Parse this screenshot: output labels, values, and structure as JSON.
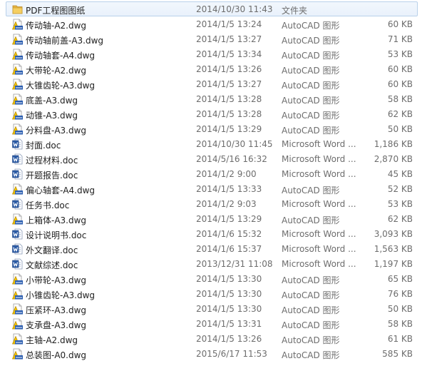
{
  "files": [
    {
      "name": "PDF工程图图纸",
      "date": "2014/10/30 11:43",
      "type": "文件夹",
      "size": "",
      "icon": "folder-icon"
    },
    {
      "name": "传动轴-A2.dwg",
      "date": "2014/1/5 13:24",
      "type": "AutoCAD 图形",
      "size": "60 KB",
      "icon": "autocad-dwg-icon"
    },
    {
      "name": "传动轴前盖-A3.dwg",
      "date": "2014/1/5 13:27",
      "type": "AutoCAD 图形",
      "size": "71 KB",
      "icon": "autocad-dwg-icon"
    },
    {
      "name": "传动轴套-A4.dwg",
      "date": "2014/1/5 13:34",
      "type": "AutoCAD 图形",
      "size": "53 KB",
      "icon": "autocad-dwg-icon"
    },
    {
      "name": "大带轮-A2.dwg",
      "date": "2014/1/5 13:26",
      "type": "AutoCAD 图形",
      "size": "60 KB",
      "icon": "autocad-dwg-icon"
    },
    {
      "name": "大锥齿轮-A3.dwg",
      "date": "2014/1/5 13:27",
      "type": "AutoCAD 图形",
      "size": "60 KB",
      "icon": "autocad-dwg-icon"
    },
    {
      "name": "底盖-A3.dwg",
      "date": "2014/1/5 13:28",
      "type": "AutoCAD 图形",
      "size": "58 KB",
      "icon": "autocad-dwg-icon"
    },
    {
      "name": "动锥-A3.dwg",
      "date": "2014/1/5 13:28",
      "type": "AutoCAD 图形",
      "size": "62 KB",
      "icon": "autocad-dwg-icon"
    },
    {
      "name": "分料盘-A3.dwg",
      "date": "2014/1/5 13:29",
      "type": "AutoCAD 图形",
      "size": "50 KB",
      "icon": "autocad-dwg-icon"
    },
    {
      "name": "封面.doc",
      "date": "2014/10/30 11:45",
      "type": "Microsoft Word ...",
      "size": "1,186 KB",
      "icon": "word-doc-icon"
    },
    {
      "name": "过程材料.doc",
      "date": "2014/5/16 16:32",
      "type": "Microsoft Word ...",
      "size": "2,870 KB",
      "icon": "word-doc-icon"
    },
    {
      "name": "开题报告.doc",
      "date": "2014/1/2 9:00",
      "type": "Microsoft Word ...",
      "size": "45 KB",
      "icon": "word-doc-icon"
    },
    {
      "name": "偏心轴套-A4.dwg",
      "date": "2014/1/5 13:33",
      "type": "AutoCAD 图形",
      "size": "52 KB",
      "icon": "autocad-dwg-icon"
    },
    {
      "name": "任务书.doc",
      "date": "2014/1/2 9:03",
      "type": "Microsoft Word ...",
      "size": "53 KB",
      "icon": "word-doc-icon"
    },
    {
      "name": "上箱体-A3.dwg",
      "date": "2014/1/5 13:29",
      "type": "AutoCAD 图形",
      "size": "62 KB",
      "icon": "autocad-dwg-icon"
    },
    {
      "name": "设计说明书.doc",
      "date": "2014/1/6 15:32",
      "type": "Microsoft Word ...",
      "size": "3,093 KB",
      "icon": "word-doc-icon"
    },
    {
      "name": "外文翻译.doc",
      "date": "2014/1/6 15:37",
      "type": "Microsoft Word ...",
      "size": "1,563 KB",
      "icon": "word-doc-icon"
    },
    {
      "name": "文献综述.doc",
      "date": "2013/12/31 11:08",
      "type": "Microsoft Word ...",
      "size": "1,197 KB",
      "icon": "word-doc-icon"
    },
    {
      "name": "小带轮-A3.dwg",
      "date": "2014/1/5 13:30",
      "type": "AutoCAD 图形",
      "size": "65 KB",
      "icon": "autocad-dwg-icon"
    },
    {
      "name": "小锥齿轮-A3.dwg",
      "date": "2014/1/5 13:30",
      "type": "AutoCAD 图形",
      "size": "76 KB",
      "icon": "autocad-dwg-icon"
    },
    {
      "name": "压紧环-A3.dwg",
      "date": "2014/1/5 13:30",
      "type": "AutoCAD 图形",
      "size": "50 KB",
      "icon": "autocad-dwg-icon"
    },
    {
      "name": "支承盘-A3.dwg",
      "date": "2014/1/5 13:31",
      "type": "AutoCAD 图形",
      "size": "58 KB",
      "icon": "autocad-dwg-icon"
    },
    {
      "name": "主轴-A2.dwg",
      "date": "2014/1/5 13:26",
      "type": "AutoCAD 图形",
      "size": "61 KB",
      "icon": "autocad-dwg-icon"
    },
    {
      "name": "总装图-A0.dwg",
      "date": "2015/6/17 11:53",
      "type": "AutoCAD 图形",
      "size": "585 KB",
      "icon": "autocad-dwg-icon"
    }
  ],
  "selected_index": 0,
  "colors": {
    "selection_border": "#b9d1ea",
    "selection_fill": "#eaf2fb",
    "meta_text": "#6d6d6d",
    "name_text": "#1e1e1e"
  }
}
